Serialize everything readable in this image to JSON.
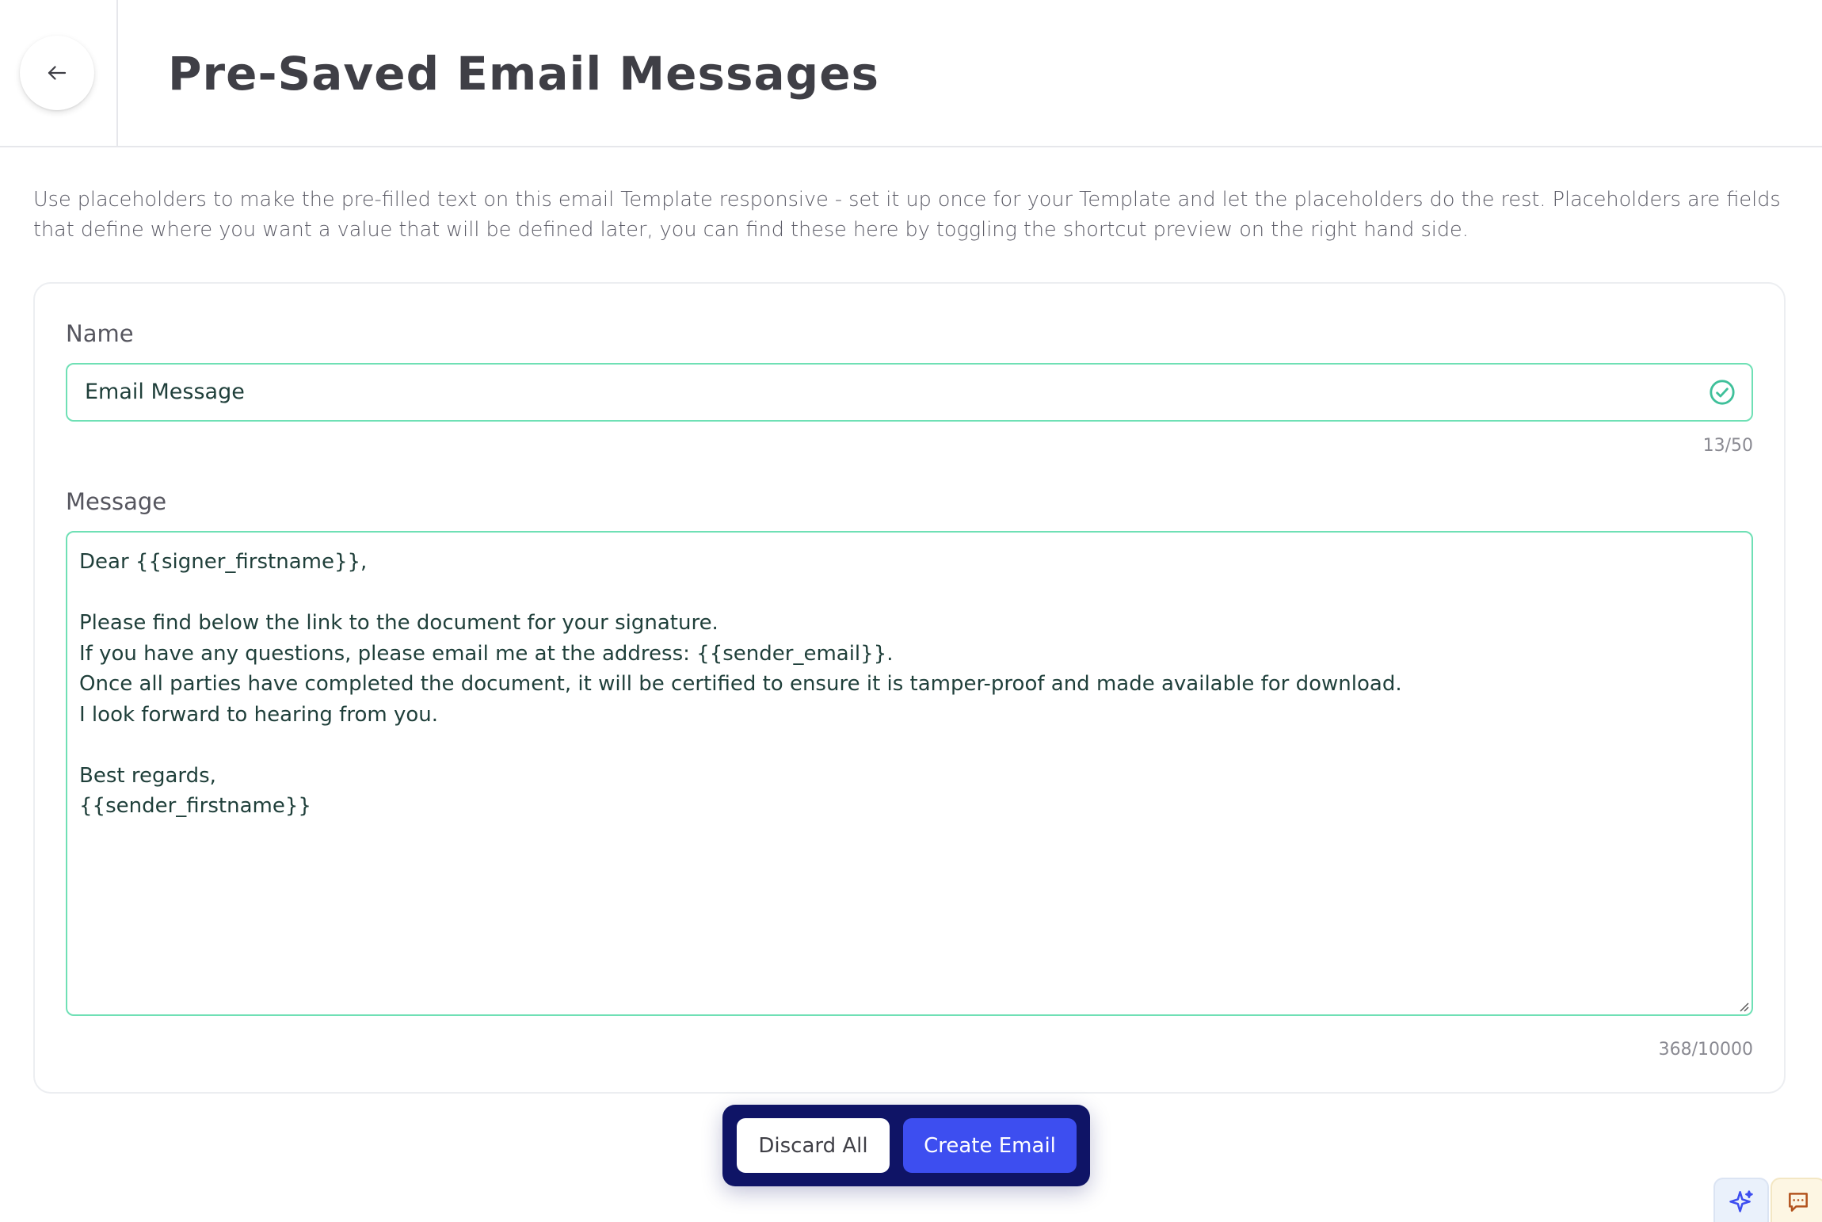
{
  "header": {
    "title": "Pre-Saved Email Messages",
    "back_icon": "arrow-left-icon"
  },
  "description": "Use placeholders to make the pre-filled text on this email Template responsive - set it up once for your Template and let the placeholders do the rest. Placeholders are fields that define where you want a value that will be defined later, you can find these here by toggling the shortcut preview on the right hand side.",
  "form": {
    "name": {
      "label": "Name",
      "value": "Email Message",
      "counter": "13/50",
      "status_icon": "check-circle-icon"
    },
    "message": {
      "label": "Message",
      "value": "Dear {{signer_firstname}},\n\nPlease find below the link to the document for your signature.\nIf you have any questions, please email me at the address: {{sender_email}}.\nOnce all parties have completed the document, it will be certified to ensure it is tamper-proof and made available for download.\nI look forward to hearing from you.\n\nBest regards,\n{{sender_firstname}}",
      "counter": "368/10000"
    }
  },
  "actions": {
    "discard_label": "Discard All",
    "create_label": "Create Email"
  },
  "floating": {
    "ai_icon": "sparkle-icon",
    "chat_icon": "chat-icon"
  },
  "colors": {
    "accent_green": "#6fe0b5",
    "primary_blue": "#3d4ef0",
    "action_bar_navy": "#0f1466"
  }
}
